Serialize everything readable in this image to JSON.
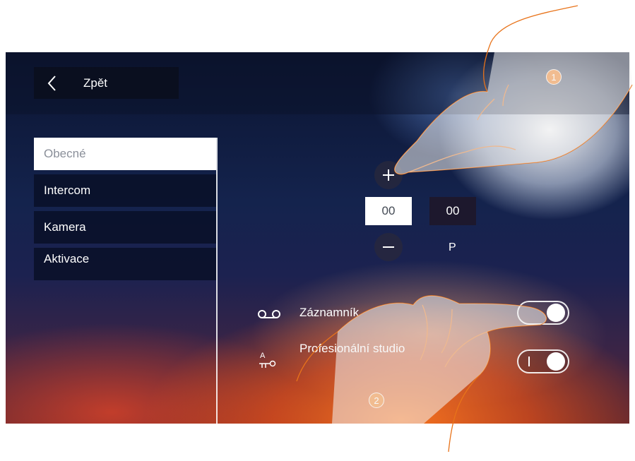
{
  "header": {
    "back_label": "Zpět"
  },
  "menu": {
    "items": [
      {
        "label": "Obecné",
        "active": true
      },
      {
        "label": "Intercom",
        "active": false
      },
      {
        "label": "Kamera",
        "active": false
      },
      {
        "label": "Aktivace",
        "active": false
      }
    ]
  },
  "time_setting": {
    "increment_icon": "plus-icon",
    "decrement_icon": "minus-icon",
    "hours": "00",
    "minutes": "00",
    "period_label": "P"
  },
  "settings": {
    "answering_machine": {
      "label": "Záznamník",
      "icon": "voicemail-icon",
      "enabled": false
    },
    "professional_studio": {
      "label": "Profesionální studio",
      "icon": "door-key-icon",
      "icon_letter": "A",
      "enabled": true
    }
  },
  "annotations": {
    "step1": "1",
    "step2": "2",
    "accent": "#f07a1a"
  }
}
